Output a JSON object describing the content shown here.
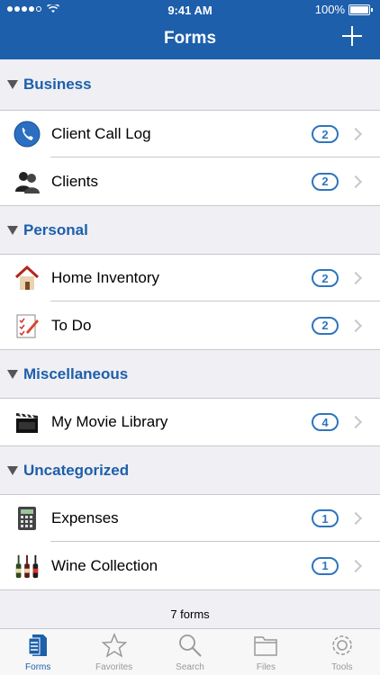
{
  "status": {
    "time": "9:41 AM",
    "battery": "100%"
  },
  "nav": {
    "title": "Forms"
  },
  "sections": [
    {
      "title": "Business",
      "rows": [
        {
          "label": "Client Call Log",
          "count": "2",
          "icon": "phone-icon"
        },
        {
          "label": "Clients",
          "count": "2",
          "icon": "people-icon"
        }
      ]
    },
    {
      "title": "Personal",
      "rows": [
        {
          "label": "Home Inventory",
          "count": "2",
          "icon": "house-icon"
        },
        {
          "label": "To Do",
          "count": "2",
          "icon": "checklist-icon"
        }
      ]
    },
    {
      "title": "Miscellaneous",
      "rows": [
        {
          "label": "My Movie Library",
          "count": "4",
          "icon": "clapperboard-icon"
        }
      ]
    },
    {
      "title": "Uncategorized",
      "rows": [
        {
          "label": "Expenses",
          "count": "1",
          "icon": "calculator-icon"
        },
        {
          "label": "Wine Collection",
          "count": "1",
          "icon": "wine-bottles-icon"
        }
      ]
    }
  ],
  "footer": "7 forms",
  "tabs": [
    {
      "label": "Forms",
      "icon": "forms-icon",
      "active": true
    },
    {
      "label": "Favorites",
      "icon": "star-icon",
      "active": false
    },
    {
      "label": "Search",
      "icon": "search-icon",
      "active": false
    },
    {
      "label": "Files",
      "icon": "folder-icon",
      "active": false
    },
    {
      "label": "Tools",
      "icon": "gear-icon",
      "active": false
    }
  ]
}
